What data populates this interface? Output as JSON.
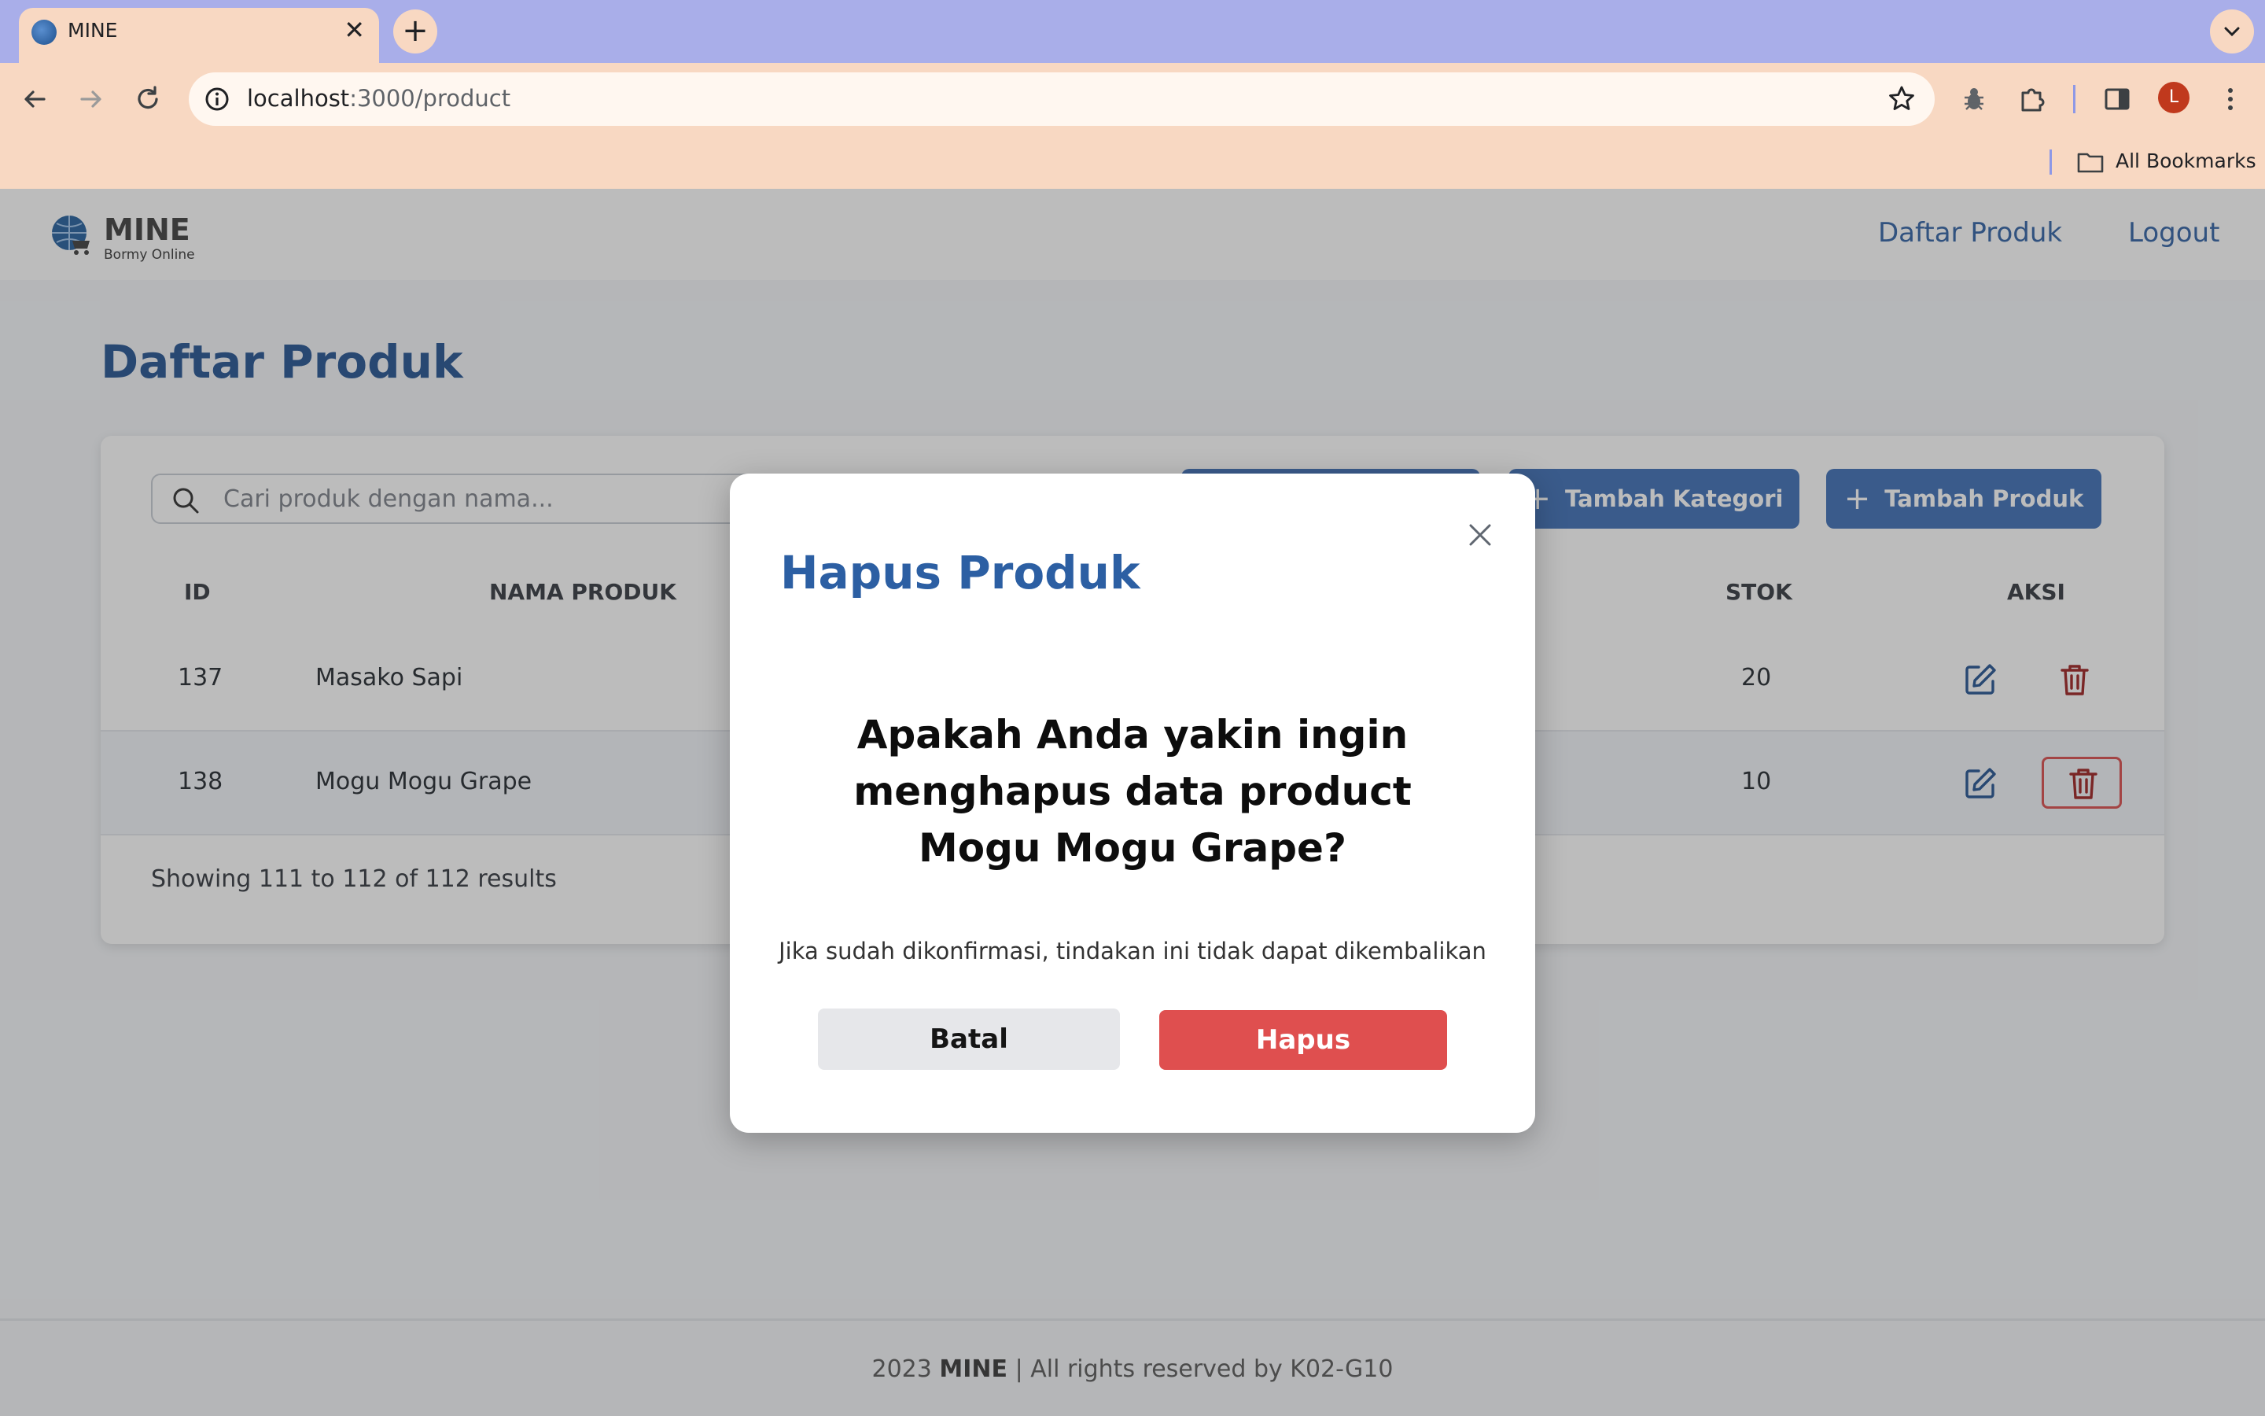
{
  "browser": {
    "tab_title": "MINE",
    "tab_close": "✕",
    "new_tab": "+",
    "url_host": "localhost",
    "url_path": ":3000/product",
    "avatar_letter": "L",
    "bookmarks_label": "All Bookmarks"
  },
  "navbar": {
    "brand": "MINE",
    "brand_sub": "Bormy Online",
    "links": [
      "Daftar Produk",
      "Logout"
    ]
  },
  "page": {
    "title": "Daftar Produk",
    "search_placeholder": "Cari produk dengan nama...",
    "buttons": {
      "add_category": "Tambah Kategori",
      "add_product": "Tambah Produk",
      "plus": "+"
    },
    "table": {
      "headers": {
        "id": "ID",
        "name": "NAMA PRODUK",
        "stock": "STOK",
        "action": "AKSI"
      },
      "rows": [
        {
          "id": "137",
          "name": "Masako Sapi",
          "stock": "20"
        },
        {
          "id": "138",
          "name": "Mogu Mogu Grape",
          "stock": "10"
        }
      ]
    },
    "pagination": "Showing 111 to 112 of 112 results"
  },
  "footer": {
    "prefix": "2023",
    "brand": "MINE",
    "suffix": "| All rights reserved by K02-G10"
  },
  "modal": {
    "title": "Hapus Produk",
    "question": "Apakah Anda yakin ingin menghapus data product Mogu Mogu Grape?",
    "note": "Jika sudah dikonfirmasi, tindakan ini tidak dapat dikembalikan",
    "cancel_label": "Batal",
    "delete_label": "Hapus"
  },
  "colors": {
    "primary": "#2c5fa3",
    "danger": "#df4f4f",
    "tab_bar": "#a9aee9",
    "toolbar": "#f8d8c2"
  }
}
